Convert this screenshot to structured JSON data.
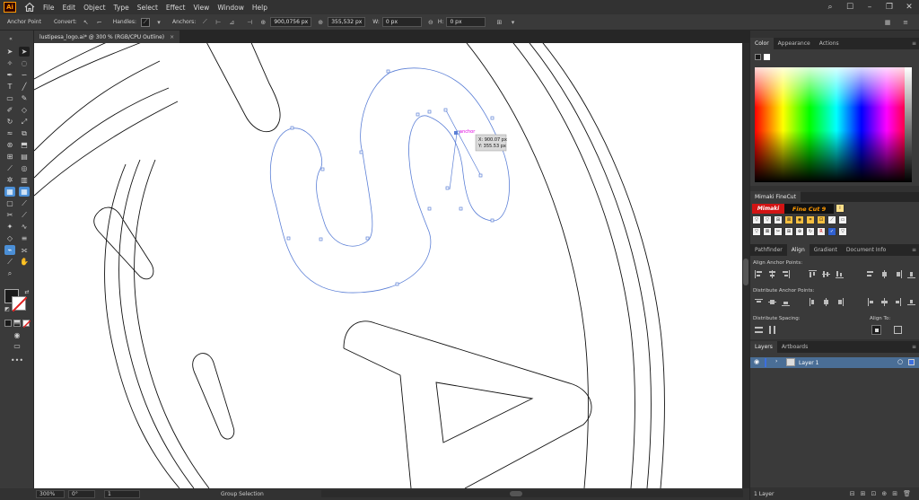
{
  "app": {
    "logo": "Ai",
    "home_icon": "home-icon"
  },
  "menu": [
    "File",
    "Edit",
    "Object",
    "Type",
    "Select",
    "Effect",
    "View",
    "Window",
    "Help"
  ],
  "window_controls": {
    "search": "search-icon",
    "minimize": "minimize-icon",
    "restore": "restore-icon",
    "close": "close-icon"
  },
  "control_bar": {
    "tool_label": "Anchor Point",
    "convert_label": "Convert:",
    "handles_label": "Handles:",
    "anchors_label": "Anchors:",
    "x_value": "900,0756 px",
    "y_value": "355,532 px",
    "w_label": "W:",
    "w_value": "0 px",
    "h_label": "H:",
    "h_value": "0 px"
  },
  "document_tab": {
    "title": "lustipesa_logo.ai* @ 300 % (RGB/CPU Outline)",
    "close": "×"
  },
  "canvas": {
    "anchor_label": "anchor",
    "tooltip_x": "X: 900.07 px",
    "tooltip_y": "Y: 355.53 px",
    "path_color": "#5b7fd6",
    "anchor_label_color": "#e000e0"
  },
  "status_bar": {
    "zoom": "300%",
    "rotation": "0°",
    "artboard": "1",
    "tool": "Group Selection"
  },
  "color_panel": {
    "tabs": [
      "Color",
      "Appearance",
      "Actions"
    ]
  },
  "mimaki": {
    "header": "Mimaki FineCut",
    "logo_left": "Mimaki",
    "logo_right": "Fine Cut 9"
  },
  "align_panel": {
    "tabs": [
      "Pathfinder",
      "Align",
      "Gradient",
      "Document Info"
    ],
    "align_anchor_label": "Align Anchor Points:",
    "distribute_anchor_label": "Distribute Anchor Points:",
    "distribute_spacing_label": "Distribute Spacing:",
    "align_to_label": "Align To:"
  },
  "layers_panel": {
    "tabs": [
      "Layers",
      "Artboards"
    ],
    "layer_name": "Layer 1",
    "footer": "1 Layer"
  }
}
